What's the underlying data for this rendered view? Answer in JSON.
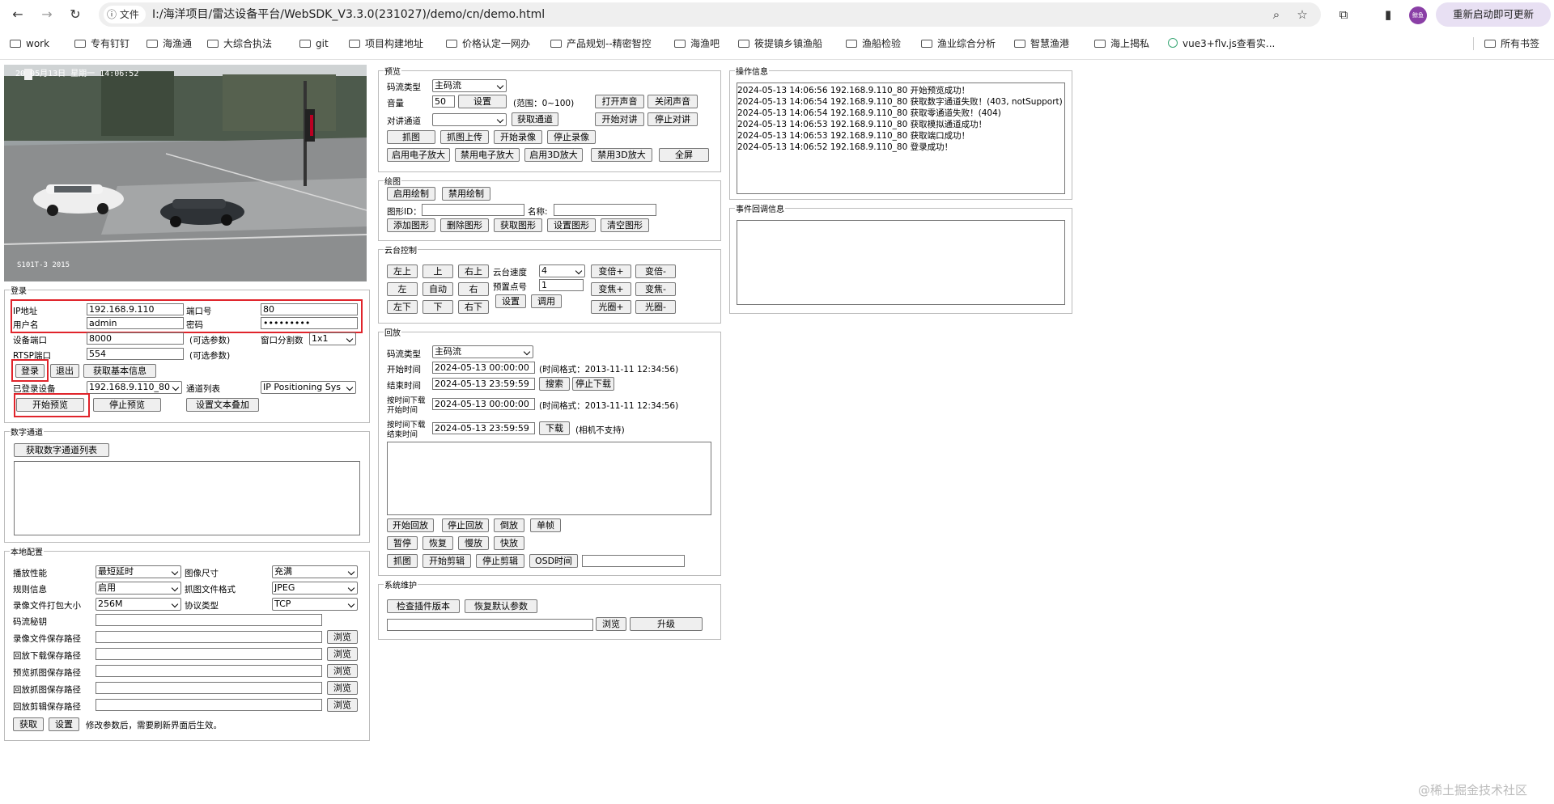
{
  "browser": {
    "file_chip": "文件",
    "url": "I:/海洋项目/雷达设备平台/WebSDK_V3.3.0(231027)/demo/cn/demo.html",
    "avatar": "鲸鱼",
    "restart_label": "重新启动即可更新",
    "bookmarks": [
      "work",
      "专有钉钉",
      "海渔通",
      "大综合执法",
      "git",
      "项目构建地址",
      "价格认定一网办",
      "产品规划--精密智控",
      "海渔吧",
      "筱提镇乡镇渔船",
      "渔船检验",
      "渔业综合分析",
      "智慧渔港",
      "海上揭私",
      "vue3+flv.js查看实..."
    ],
    "all_bookmarks": "所有书签"
  },
  "video": {
    "osd_top": "20  05月13日 星期一 14:06:52",
    "osd_bottom": "S101T-3    2015"
  },
  "login": {
    "legend": "登录",
    "ip_label": "IP地址",
    "ip": "192.168.9.110",
    "port_label": "端口号",
    "port": "80",
    "user_label": "用户名",
    "user": "admin",
    "pass_label": "密码",
    "pass": "•••••••••",
    "devport_label": "设备端口",
    "devport": "8000",
    "optional": "(可选参数)",
    "wnd_label": "窗口分割数",
    "wnd": "1x1",
    "rtsp_label": "RTSP端口",
    "rtsp": "554",
    "login_btn": "登录",
    "logout_btn": "退出",
    "getinfo_btn": "获取基本信息",
    "logged_label": "已登录设备",
    "logged": "192.168.9.110_80",
    "chan_label": "通道列表",
    "chan": "IP Positioning Sys",
    "start_btn": "开始预览",
    "stop_btn": "停止预览",
    "osd_btn": "设置文本叠加"
  },
  "digital": {
    "legend": "数字通道",
    "btn": "获取数字通道列表"
  },
  "local": {
    "legend": "本地配置",
    "play_label": "播放性能",
    "play": "最短延时",
    "size_label": "图像尺寸",
    "size": "充满",
    "rule_label": "规则信息",
    "rule": "启用",
    "capfmt_label": "抓图文件格式",
    "capfmt": "JPEG",
    "pack_label": "录像文件打包大小",
    "pack": "256M",
    "proto_label": "协议类型",
    "proto": "TCP",
    "secret_label": "码流秘钥",
    "paths": [
      "录像文件保存路径",
      "回放下载保存路径",
      "预览抓图保存路径",
      "回放抓图保存路径",
      "回放剪辑保存路径"
    ],
    "browse": "浏览",
    "get_btn": "获取",
    "set_btn": "设置",
    "note": "修改参数后，需要刷新界面后生效。"
  },
  "preview": {
    "legend": "预览",
    "stream_label": "码流类型",
    "stream": "主码流",
    "vol_label": "音量",
    "vol": "50",
    "set": "设置",
    "range": "(范围：0~100)",
    "open_sound": "打开声音",
    "close_sound": "关闭声音",
    "talk_label": "对讲通道",
    "get_chan": "获取通道",
    "start_talk": "开始对讲",
    "stop_talk": "停止对讲",
    "row3": [
      "抓图",
      "抓图上传",
      "开始录像",
      "停止录像"
    ],
    "row4": [
      "启用电子放大",
      "禁用电子放大",
      "启用3D放大",
      "禁用3D放大",
      "全屏"
    ]
  },
  "draw": {
    "legend": "绘图",
    "enable": "启用绘制",
    "disable": "禁用绘制",
    "id_label": "图形ID：",
    "name_label": "名称:",
    "row": [
      "添加图形",
      "删除图形",
      "获取图形",
      "设置图形",
      "清空图形"
    ]
  },
  "ptz": {
    "legend": "云台控制",
    "dirs": [
      "左上",
      "上",
      "右上",
      "左",
      "自动",
      "右",
      "左下",
      "下",
      "右下"
    ],
    "speed_label": "云台速度",
    "speed": "4",
    "preset_label": "预置点号",
    "preset": "1",
    "set": "设置",
    "call": "调用",
    "zoom": [
      "变倍+",
      "变倍-",
      "变焦+",
      "变焦-",
      "光圈+",
      "光圈-"
    ]
  },
  "playback": {
    "legend": "回放",
    "stream_label": "码流类型",
    "stream": "主码流",
    "start_label": "开始时间",
    "start": "2024-05-13 00:00:00",
    "fmt": "(时间格式：2013-11-11 12:34:56)",
    "end_label": "结束时间",
    "end": "2024-05-13 23:59:59",
    "search": "搜索",
    "stop_dl": "停止下载",
    "dl_start_label1": "按时间下载",
    "dl_start_label2": "开始时间",
    "dl_start": "2024-05-13 00:00:00",
    "dl_end_label1": "按时间下载",
    "dl_end_label2": "结束时间",
    "dl_end": "2024-05-13 23:59:59",
    "download": "下载",
    "unsupported": "(相机不支持)",
    "row1": [
      "开始回放",
      "停止回放",
      "倒放",
      "单帧"
    ],
    "row2": [
      "暂停",
      "恢复",
      "慢放",
      "快放"
    ],
    "row3": [
      "抓图",
      "开始剪辑",
      "停止剪辑",
      "OSD时间"
    ]
  },
  "sysmaint": {
    "legend": "系统维护",
    "check": "检查插件版本",
    "restore": "恢复默认参数",
    "browse": "浏览",
    "upgrade": "升级"
  },
  "oplog": {
    "legend": "操作信息",
    "lines": [
      "2024-05-13 14:06:56 192.168.9.110_80 开始预览成功！",
      "2024-05-13 14:06:54 192.168.9.110_80 获取数字通道失败！(403, notSupport)",
      "2024-05-13 14:06:54 192.168.9.110_80 获取零通道失败！(404)",
      "2024-05-13 14:06:53 192.168.9.110_80 获取模拟通道成功！",
      "2024-05-13 14:06:53 192.168.9.110_80 获取端口成功！",
      "2024-05-13 14:06:52 192.168.9.110_80 登录成功！"
    ]
  },
  "event": {
    "legend": "事件回调信息"
  },
  "watermark": "@稀土掘金技术社区"
}
